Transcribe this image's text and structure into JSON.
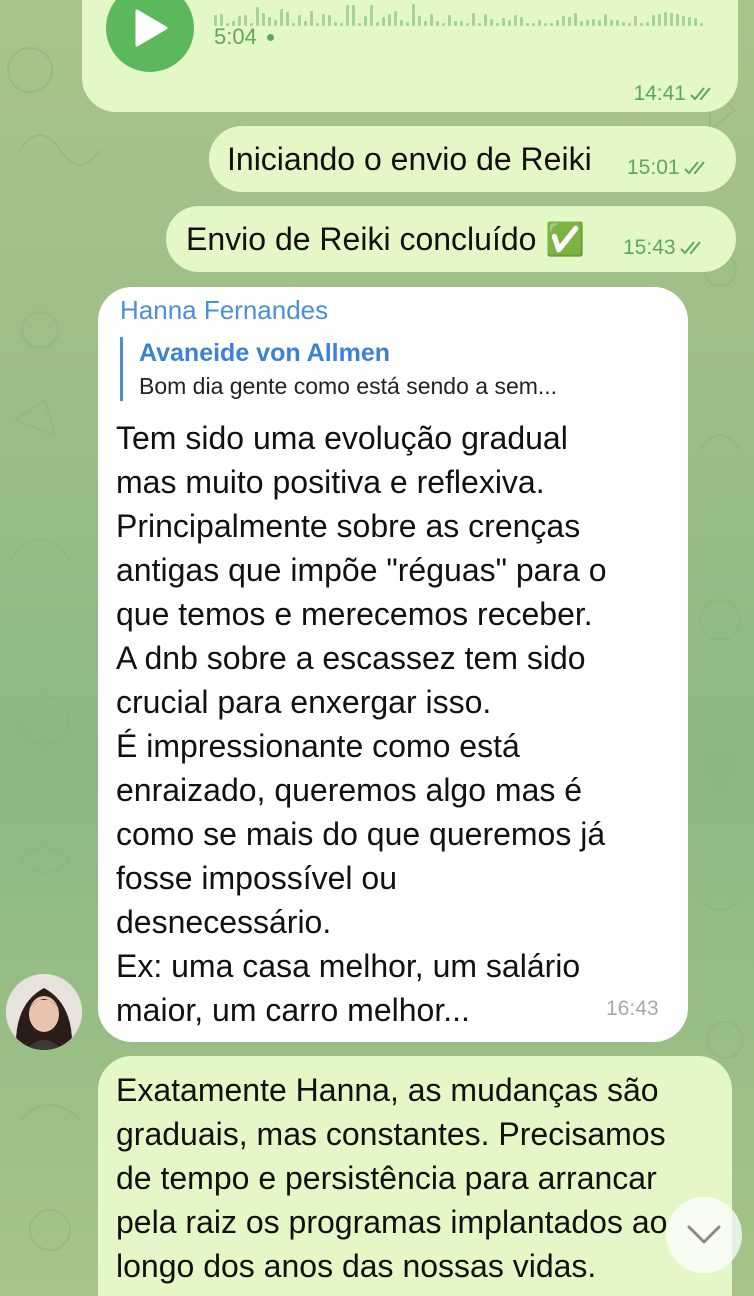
{
  "voice_message": {
    "duration": "5:04",
    "time": "14:41"
  },
  "messages": [
    {
      "text": "Iniciando o envio de Reiki",
      "time": "15:01"
    },
    {
      "text": "Envio de Reiki concluído ✅",
      "time": "15:43"
    }
  ],
  "incoming": {
    "sender": "Hanna Fernandes",
    "reply_to_name": "Avaneide von Allmen",
    "reply_to_text": "Bom dia gente como está sendo a sem...",
    "lines": [
      "Tem sido uma evolução gradual",
      "mas muito positiva e reflexiva.",
      "Principalmente sobre as crenças",
      "antigas que impõe \"réguas\" para o",
      "que temos e merecemos receber.",
      "A dnb sobre a escassez tem sido",
      "crucial para enxergar isso.",
      "É impressionante como está",
      "enraizado, queremos algo mas é",
      "como se mais do que queremos já",
      "fosse impossível ou",
      "desnecessário.",
      "Ex: uma casa melhor, um salário",
      "maior, um carro melhor..."
    ],
    "time": "16:43"
  },
  "reply_out": {
    "lines": [
      "Exatamente Hanna, as mudanças são",
      "graduais, mas constantes. Precisamos",
      "de tempo e persistência para arrancar",
      "pela raiz os programas implantados ao",
      "longo dos anos das nossas vidas."
    ]
  },
  "icons": {
    "play": "play-icon",
    "read": "double-check-icon",
    "scroll": "chevron-down-icon"
  },
  "colors": {
    "outgoing_bubble": "#e3f8c6",
    "incoming_bubble": "#ffffff",
    "accent_green": "#5cb85c",
    "sender_blue": "#4a90d9"
  }
}
